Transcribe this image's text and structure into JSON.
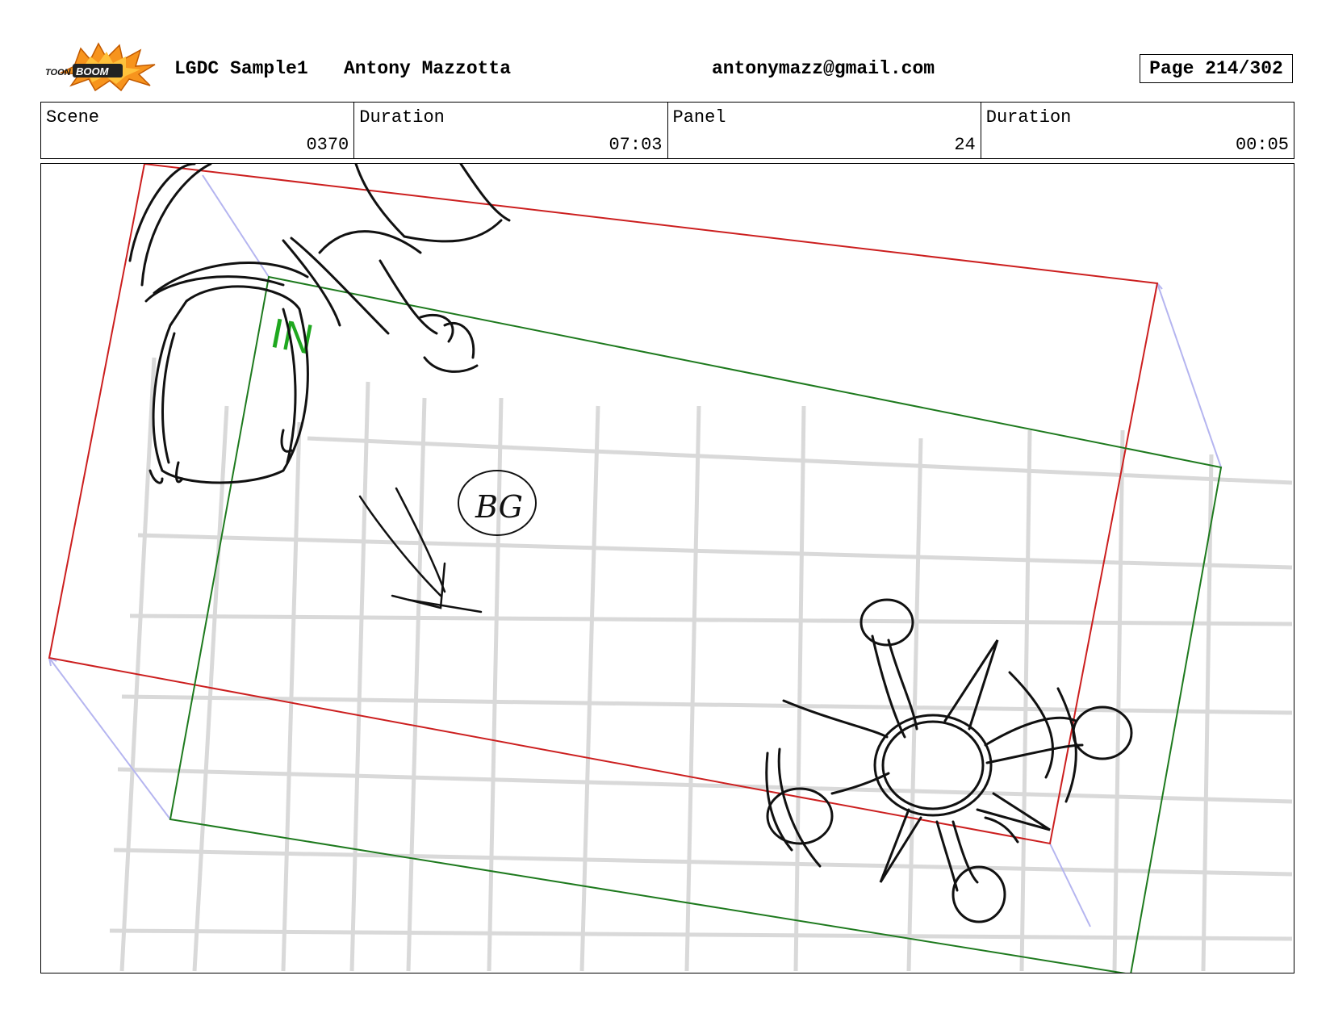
{
  "header": {
    "logo_text": "TOONBOOM",
    "project": "LGDC Sample1",
    "author": "Antony Mazzotta",
    "email": "antonymazz@gmail.com",
    "page": "Page 214/302"
  },
  "info": {
    "scene_label": "Scene",
    "scene_value": "0370",
    "scene_duration_label": "Duration",
    "scene_duration_value": "07:03",
    "panel_label": "Panel",
    "panel_value": "24",
    "panel_duration_label": "Duration",
    "panel_duration_value": "00:05"
  },
  "drawing": {
    "in_label": "IN",
    "bg_note": "BG",
    "colors": {
      "out_frame": "#cc1f1f",
      "in_frame": "#1e7a1e",
      "in_text": "#1fa81f",
      "camera_path": "#b5b5f0",
      "grid": "#c8c8c8",
      "sketch": "#111111"
    }
  }
}
